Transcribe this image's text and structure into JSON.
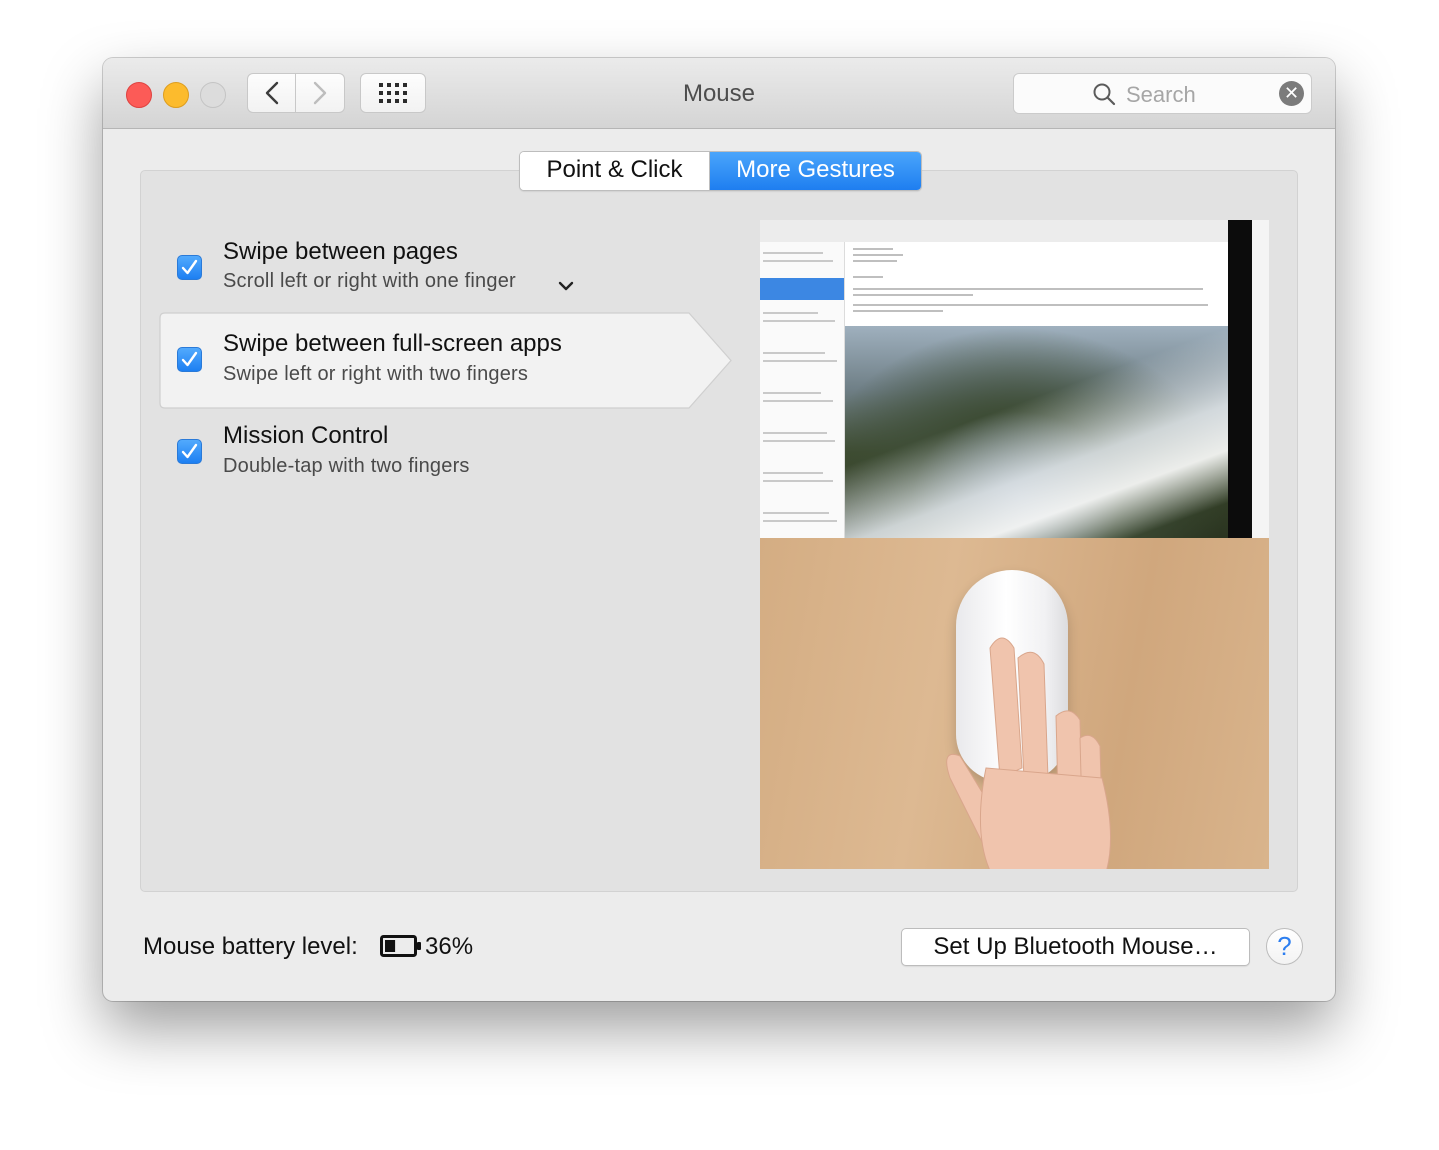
{
  "window": {
    "title": "Mouse"
  },
  "search": {
    "placeholder": "Search"
  },
  "tabs": [
    {
      "label": "Point & Click",
      "active": false
    },
    {
      "label": "More Gestures",
      "active": true
    }
  ],
  "gestures": [
    {
      "title": "Swipe between pages",
      "subtitle": "Scroll left or right with one finger",
      "checked": true,
      "has_dropdown": true
    },
    {
      "title": "Swipe between full-screen apps",
      "subtitle": "Swipe left or right with two fingers",
      "checked": true,
      "selected": true
    },
    {
      "title": "Mission Control",
      "subtitle": "Double-tap with two fingers",
      "checked": true
    }
  ],
  "footer": {
    "battery_label": "Mouse battery level:",
    "battery_percent": "36%",
    "battery_level": 0.36,
    "setup_button": "Set Up Bluetooth Mouse…",
    "help_glyph": "?"
  },
  "colors": {
    "accent": "#1e7ef0",
    "close": "#fc5b57",
    "minimize": "#fcbb2d",
    "zoom": "#dcdcdc"
  },
  "icons": {
    "back": "chevron-left-icon",
    "forward": "chevron-right-icon",
    "grid": "grid-icon",
    "search": "search-icon",
    "clear": "clear-icon",
    "checkbox": "checkmark-icon",
    "dropdown": "chevron-down-icon",
    "battery": "battery-icon",
    "help": "help-icon"
  }
}
